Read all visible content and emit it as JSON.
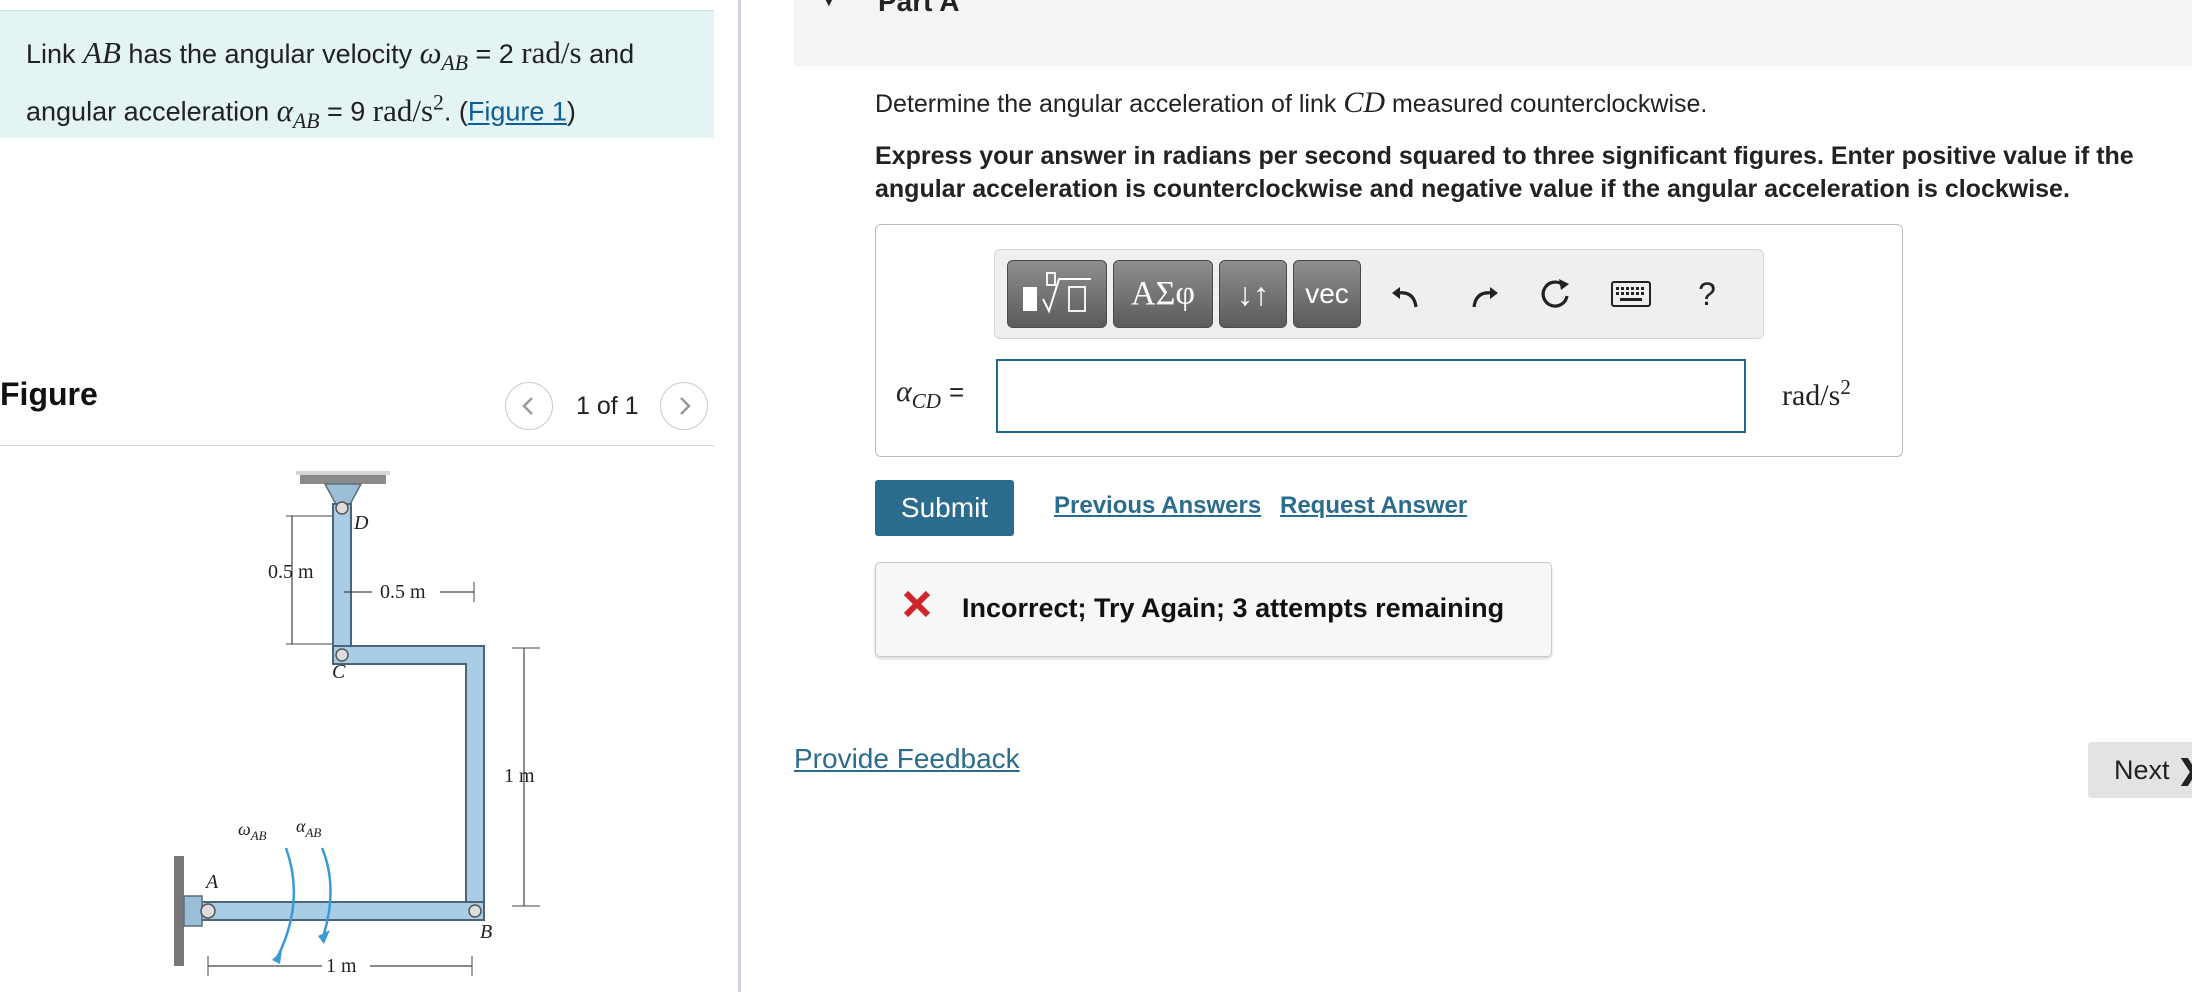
{
  "problem": {
    "text_1": "Link ",
    "link_name": "AB",
    "text_2": " has the angular velocity ",
    "omega_symbol": "ω",
    "omega_sub": "AB",
    "omega_eq": " = 2 ",
    "omega_unit": "rad/s",
    "text_3": " and angular acceleration ",
    "alpha_symbol": "α",
    "alpha_sub": "AB",
    "alpha_eq": " = 9 ",
    "alpha_unit": "rad/s",
    "alpha_unit_sup": "2",
    "text_4": ". (",
    "figure_link": "Figure 1",
    "text_5": ")"
  },
  "figure": {
    "title": "Figure",
    "counter": "1 of 1",
    "labels": {
      "d": "D",
      "c": "C",
      "a": "A",
      "b": "B",
      "dim_half_vertical": "0.5 m",
      "dim_half_horizontal": "0.5 m",
      "dim_one_vertical": "1 m",
      "dim_one_horizontal": "1 m",
      "omega": "ω",
      "omega_sub": "AB",
      "alpha": "α",
      "alpha_sub": "AB"
    }
  },
  "part": {
    "title": "Part A",
    "caret": "▼"
  },
  "question": {
    "text_1": "Determine the angular acceleration of link ",
    "link_name": "CD",
    "text_2": " measured counterclockwise."
  },
  "instructions": "Express your answer in radians per second squared to three significant figures. Enter positive value if the angular acceleration is counterclockwise and negative value if the angular acceleration is clockwise.",
  "toolbar": {
    "greek_label": "ΑΣφ",
    "arrows_label": "↓↑",
    "vec_label": "vec",
    "help_label": "?"
  },
  "answer": {
    "symbol": "α",
    "symbol_sub": "CD",
    "equals": "=",
    "value": "",
    "unit": "rad/s",
    "unit_sup": "2"
  },
  "actions": {
    "submit": "Submit",
    "previous_answers": "Previous Answers",
    "request_answer": "Request Answer"
  },
  "feedback": {
    "message": "Incorrect; Try Again; 3 attempts remaining",
    "icon": "x-mark-icon",
    "color": "#d0262b"
  },
  "footer": {
    "provide_feedback": "Provide Feedback",
    "next": "Next",
    "next_chevron": "❯"
  },
  "colors": {
    "problem_bg": "#e4f3f4",
    "link": "#2b6b8e",
    "submit_bg": "#2b6b8e",
    "input_border": "#1f6b8c",
    "mechanism_fill": "#a9cde6"
  }
}
